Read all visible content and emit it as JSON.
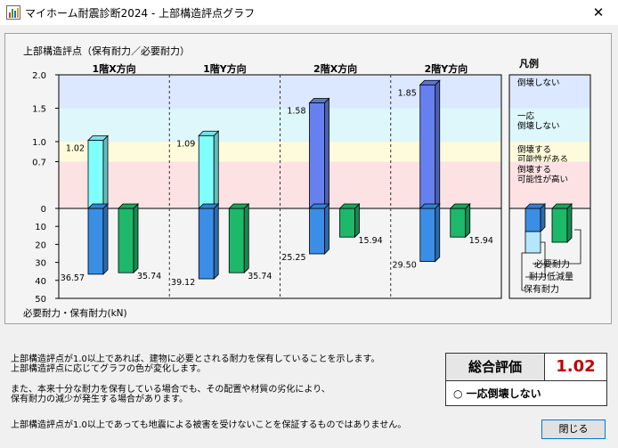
{
  "window": {
    "title": "マイホーム耐震診断2024 - 上部構造評点グラフ",
    "close_glyph": "✕"
  },
  "chart": {
    "title": "上部構造評点（保有耐力／必要耐力）",
    "bottom_label": "必要耐力・保有耐力(kN)",
    "legend_title": "凡例",
    "zones": [
      {
        "label": "倒壊しない",
        "from": 1.5,
        "to": 2.0,
        "color": "#dce8ff"
      },
      {
        "label": "一応\n倒壊しない",
        "from": 1.0,
        "to": 1.5,
        "color": "#def7fb"
      },
      {
        "label": "倒壊する\n可能性がある",
        "from": 0.7,
        "to": 1.0,
        "color": "#fdfbdb"
      },
      {
        "label": "倒壊する\n可能性が高い",
        "from": 0.0,
        "to": 0.7,
        "color": "#fde2e4"
      }
    ],
    "upper_ticks": [
      "2.0",
      "1.5",
      "1.0",
      "0.7",
      "0"
    ],
    "upper_tick_values": [
      2.0,
      1.5,
      1.0,
      0.7,
      0
    ],
    "lower_ticks": [
      "10",
      "20",
      "30",
      "40",
      "50"
    ],
    "lower_tick_values": [
      10,
      20,
      30,
      40,
      50
    ],
    "legend_items": [
      "必要耐力",
      "耐力低減量",
      "保有耐力"
    ]
  },
  "chart_data": {
    "type": "bar",
    "categories": [
      "1階X方向",
      "1階Y方向",
      "2階X方向",
      "2階Y方向"
    ],
    "upper_ylim": [
      0,
      2.0
    ],
    "lower_ylim": [
      0,
      50
    ],
    "series": [
      {
        "name": "上部構造評点",
        "values": [
          1.02,
          1.09,
          1.58,
          1.85
        ],
        "labels": [
          "1.02",
          "1.09",
          "1.58",
          "1.85"
        ]
      },
      {
        "name": "保有耐力",
        "values": [
          36.57,
          39.12,
          25.25,
          29.5
        ],
        "labels": [
          "36.57",
          "39.12",
          "25.25",
          "29.50"
        ]
      },
      {
        "name": "必要耐力",
        "values": [
          35.74,
          35.74,
          15.94,
          15.94
        ],
        "labels": [
          "35.74",
          "35.74",
          "15.94",
          "15.94"
        ]
      }
    ],
    "bar_colors": [
      "#80ffff",
      "#80ffff",
      "#6680f0",
      "#6680f0"
    ],
    "holding_color": "#3a8ee6",
    "required_color": "#1db86a"
  },
  "description": {
    "lines": [
      "上部構造評点が1.0以上であれば、建物に必要とされる耐力を保有していることを示します。",
      "上部構造評点に応じてグラフの色が変化します。",
      "また、本来十分な耐力を保有している場合でも、その配置や材質の劣化により、",
      "保有耐力の減少が発生する場合があります。",
      "上部構造評点が1.0以上であっても地震による被害を受けないことを保証するものではありません。"
    ]
  },
  "evaluation": {
    "label": "総合評価",
    "value": "1.02",
    "result": "○ 一応倒壊しない"
  },
  "buttons": {
    "close_label": "閉じる"
  }
}
